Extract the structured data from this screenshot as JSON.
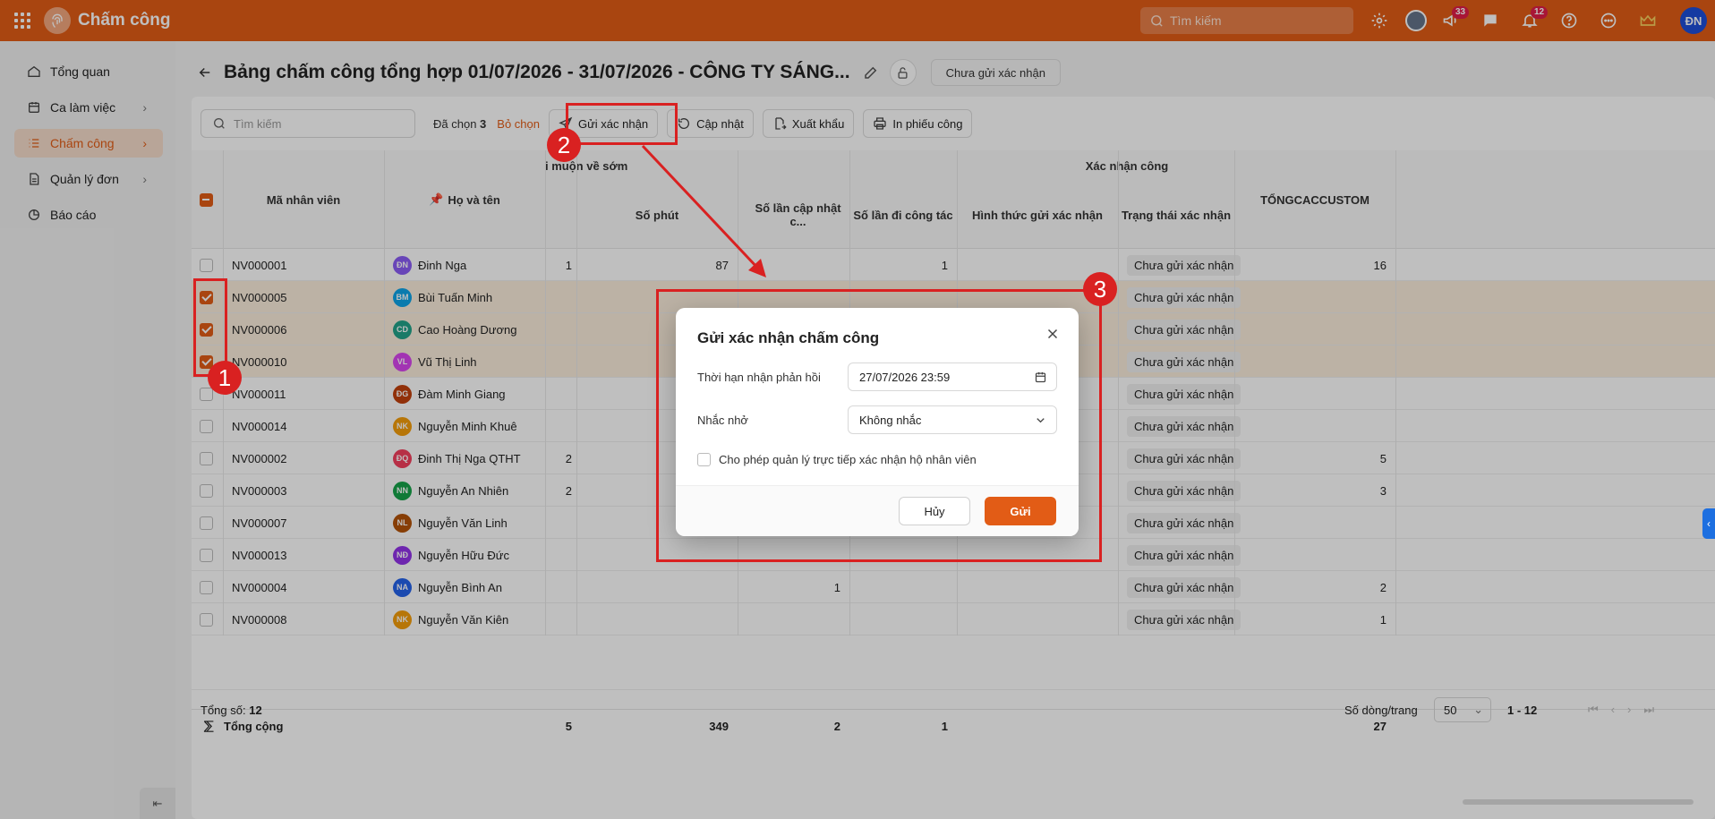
{
  "app": {
    "title": "Chấm công",
    "search_placeholder": "Tìm kiếm",
    "user_initials": "ĐN",
    "badges": {
      "announcements": "33",
      "notifications": "12"
    }
  },
  "sidebar": {
    "items": [
      {
        "label": "Tổng quan",
        "icon": "home-icon",
        "has_chevron": false
      },
      {
        "label": "Ca làm việc",
        "icon": "calendar-icon",
        "has_chevron": true
      },
      {
        "label": "Chấm công",
        "icon": "list-icon",
        "has_chevron": true,
        "active": true
      },
      {
        "label": "Quản lý đơn",
        "icon": "document-icon",
        "has_chevron": true
      },
      {
        "label": "Báo cáo",
        "icon": "pie-chart-icon",
        "has_chevron": false
      }
    ]
  },
  "header": {
    "title": "Bảng chấm công tổng hợp 01/07/2026 - 31/07/2026 - CÔNG TY SÁNG...",
    "status": "Chưa gửi xác nhận"
  },
  "toolbar": {
    "search_placeholder": "Tìm kiếm",
    "selected_prefix": "Đã chọn",
    "selected_count": "3",
    "deselect": "Bỏ chọn",
    "send_confirm": "Gửi xác nhận",
    "update": "Cập nhật",
    "export": "Xuất khẩu",
    "print": "In phiếu công"
  },
  "table": {
    "group_headers": {
      "late_early": "i muộn về sớm",
      "confirm": "Xác nhận công"
    },
    "headers": {
      "employee_id": "Mã nhân viên",
      "name": "Họ và tên",
      "minutes": "Số phút",
      "update_count": "Số lần cập nhật c...",
      "trip_count": "Số lần đi công tác",
      "send_method": "Hình thức gửi xác nhận",
      "confirm_status": "Trạng thái xác nhận",
      "custom": "TỔNGCACCUSTOM"
    },
    "rows": [
      {
        "id": "NV000001",
        "initials": "ĐN",
        "color": "#8b5cf6",
        "name": "Đinh Nga",
        "late": "1",
        "minutes": "87",
        "updates": "",
        "trips": "1",
        "status": "Chưa gửi xác nhận",
        "custom": "16",
        "checked": false
      },
      {
        "id": "NV000005",
        "initials": "BM",
        "color": "#0ea5e9",
        "name": "Bùi Tuấn Minh",
        "late": "",
        "minutes": "",
        "updates": "",
        "trips": "",
        "status": "Chưa gửi xác nhận",
        "custom": "",
        "checked": true
      },
      {
        "id": "NV000006",
        "initials": "CD",
        "color": "#22a38a",
        "name": "Cao Hoàng Dương",
        "late": "",
        "minutes": "",
        "updates": "",
        "trips": "",
        "status": "Chưa gửi xác nhận",
        "custom": "",
        "checked": true
      },
      {
        "id": "NV000010",
        "initials": "VL",
        "color": "#d946ef",
        "name": "Vũ Thị Linh",
        "late": "",
        "minutes": "",
        "updates": "",
        "trips": "",
        "status": "Chưa gửi xác nhận",
        "custom": "",
        "checked": true
      },
      {
        "id": "NV000011",
        "initials": "ĐG",
        "color": "#c2410c",
        "name": "Đàm Minh Giang",
        "late": "",
        "minutes": "",
        "updates": "",
        "trips": "",
        "status": "Chưa gửi xác nhận",
        "custom": "",
        "checked": false
      },
      {
        "id": "NV000014",
        "initials": "NK",
        "color": "#f59e0b",
        "name": "Nguyễn Minh Khuê",
        "late": "",
        "minutes": "",
        "updates": "",
        "trips": "",
        "status": "Chưa gửi xác nhận",
        "custom": "",
        "checked": false
      },
      {
        "id": "NV000002",
        "initials": "ĐQ",
        "color": "#f43f5e",
        "name": "Đinh Thị Nga QTHT",
        "late": "2",
        "minutes": "",
        "updates": "",
        "trips": "",
        "status": "Chưa gửi xác nhận",
        "custom": "5",
        "checked": false
      },
      {
        "id": "NV000003",
        "initials": "NN",
        "color": "#16a34a",
        "name": "Nguyễn An Nhiên",
        "late": "2",
        "minutes": "",
        "updates": "",
        "trips": "",
        "status": "Chưa gửi xác nhận",
        "custom": "3",
        "checked": false
      },
      {
        "id": "NV000007",
        "initials": "NL",
        "color": "#b45309",
        "name": "Nguyễn Văn Linh",
        "late": "",
        "minutes": "",
        "updates": "",
        "trips": "",
        "status": "Chưa gửi xác nhận",
        "custom": "",
        "checked": false
      },
      {
        "id": "NV000013",
        "initials": "NĐ",
        "color": "#9333ea",
        "name": "Nguyễn Hữu Đức",
        "late": "",
        "minutes": "",
        "updates": "",
        "trips": "",
        "status": "Chưa gửi xác nhận",
        "custom": "",
        "checked": false
      },
      {
        "id": "NV000004",
        "initials": "NA",
        "color": "#2563eb",
        "name": "Nguyễn Bình An",
        "late": "",
        "minutes": "",
        "updates": "1",
        "trips": "",
        "status": "Chưa gửi xác nhận",
        "custom": "2",
        "checked": false
      },
      {
        "id": "NV000008",
        "initials": "NK",
        "color": "#f59e0b",
        "name": "Nguyễn Văn Kiên",
        "late": "",
        "minutes": "",
        "updates": "",
        "trips": "",
        "status": "Chưa gửi xác nhận",
        "custom": "1",
        "checked": false
      }
    ],
    "totals": {
      "label": "Tổng cộng",
      "late": "5",
      "minutes": "349",
      "updates": "2",
      "trips": "1",
      "custom": "27"
    }
  },
  "footer": {
    "total_label": "Tổng số:",
    "total_value": "12",
    "rows_per_page_label": "Số dòng/trang",
    "rows_per_page": "50",
    "range": "1 - 12"
  },
  "modal": {
    "title": "Gửi xác nhận chấm công",
    "deadline_label": "Thời hạn nhận phản hồi",
    "deadline_value": "27/07/2026 23:59",
    "reminder_label": "Nhắc nhở",
    "reminder_value": "Không nhắc",
    "allow_manager_label": "Cho phép quản lý trực tiếp xác nhận hộ nhân viên",
    "cancel": "Hủy",
    "send": "Gửi"
  },
  "annotations": {
    "marker1": "1",
    "marker2": "2",
    "marker3": "3",
    "color": "#d92121"
  }
}
